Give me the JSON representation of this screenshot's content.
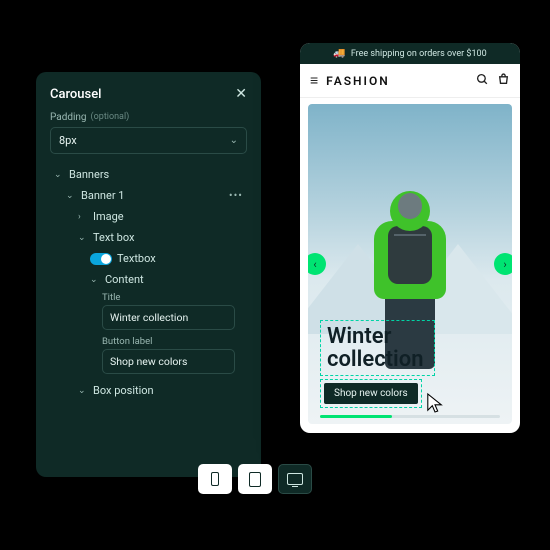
{
  "panel": {
    "title": "Carousel",
    "padding_label": "Padding",
    "padding_optional": "(optional)",
    "padding_value": "8px",
    "tree": {
      "banners": "Banners",
      "banner1": "Banner 1",
      "image": "Image",
      "textbox": "Text box",
      "textbox_toggle": "Textbox",
      "content": "Content",
      "title_label": "Title",
      "title_value": "Winter collection",
      "button_label": "Button label",
      "button_value": "Shop new colors",
      "box_position": "Box position"
    }
  },
  "preview": {
    "promo": "Free shipping on orders over $100",
    "brand": "FASHION",
    "hero_title_line1": "Winter",
    "hero_title_line2": "collection",
    "hero_button": "Shop new colors"
  }
}
